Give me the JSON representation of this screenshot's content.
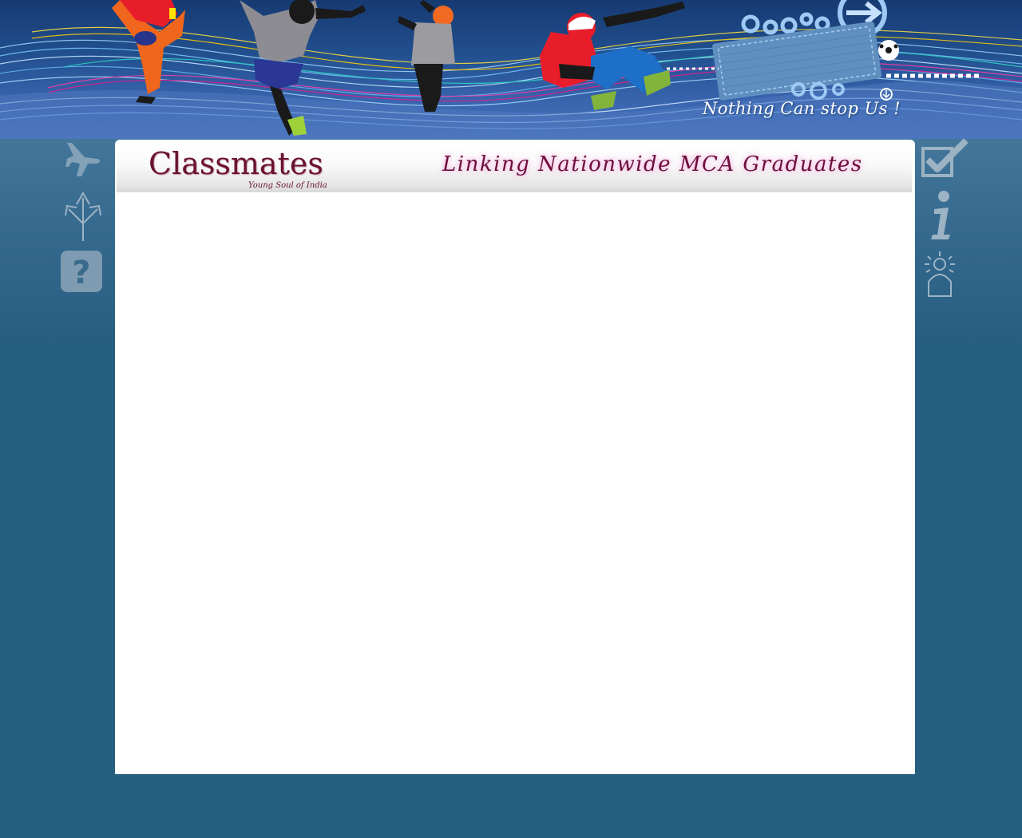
{
  "banner": {
    "tagline": "Nothing Can stop Us !",
    "illustration": "dancers-silhouettes-with-colorful-waves",
    "badge": "denim-patch-with-arrow-icon"
  },
  "left_nav": [
    {
      "icon": "airplane-icon"
    },
    {
      "icon": "fork-arrows-icon"
    },
    {
      "icon": "help-question-icon"
    }
  ],
  "right_nav": [
    {
      "icon": "checkbox-icon"
    },
    {
      "icon": "info-icon"
    },
    {
      "icon": "person-spotlight-icon"
    }
  ],
  "header": {
    "logo_title": "Classmates",
    "logo_subtitle": "Young Soul of India",
    "slogan": "Linking Nationwide MCA Graduates"
  },
  "colors": {
    "page_background": "#265e80",
    "banner_blue": "#22508f",
    "logo_maroon": "#6a1230",
    "slogan_glow": "#f3b3df"
  }
}
